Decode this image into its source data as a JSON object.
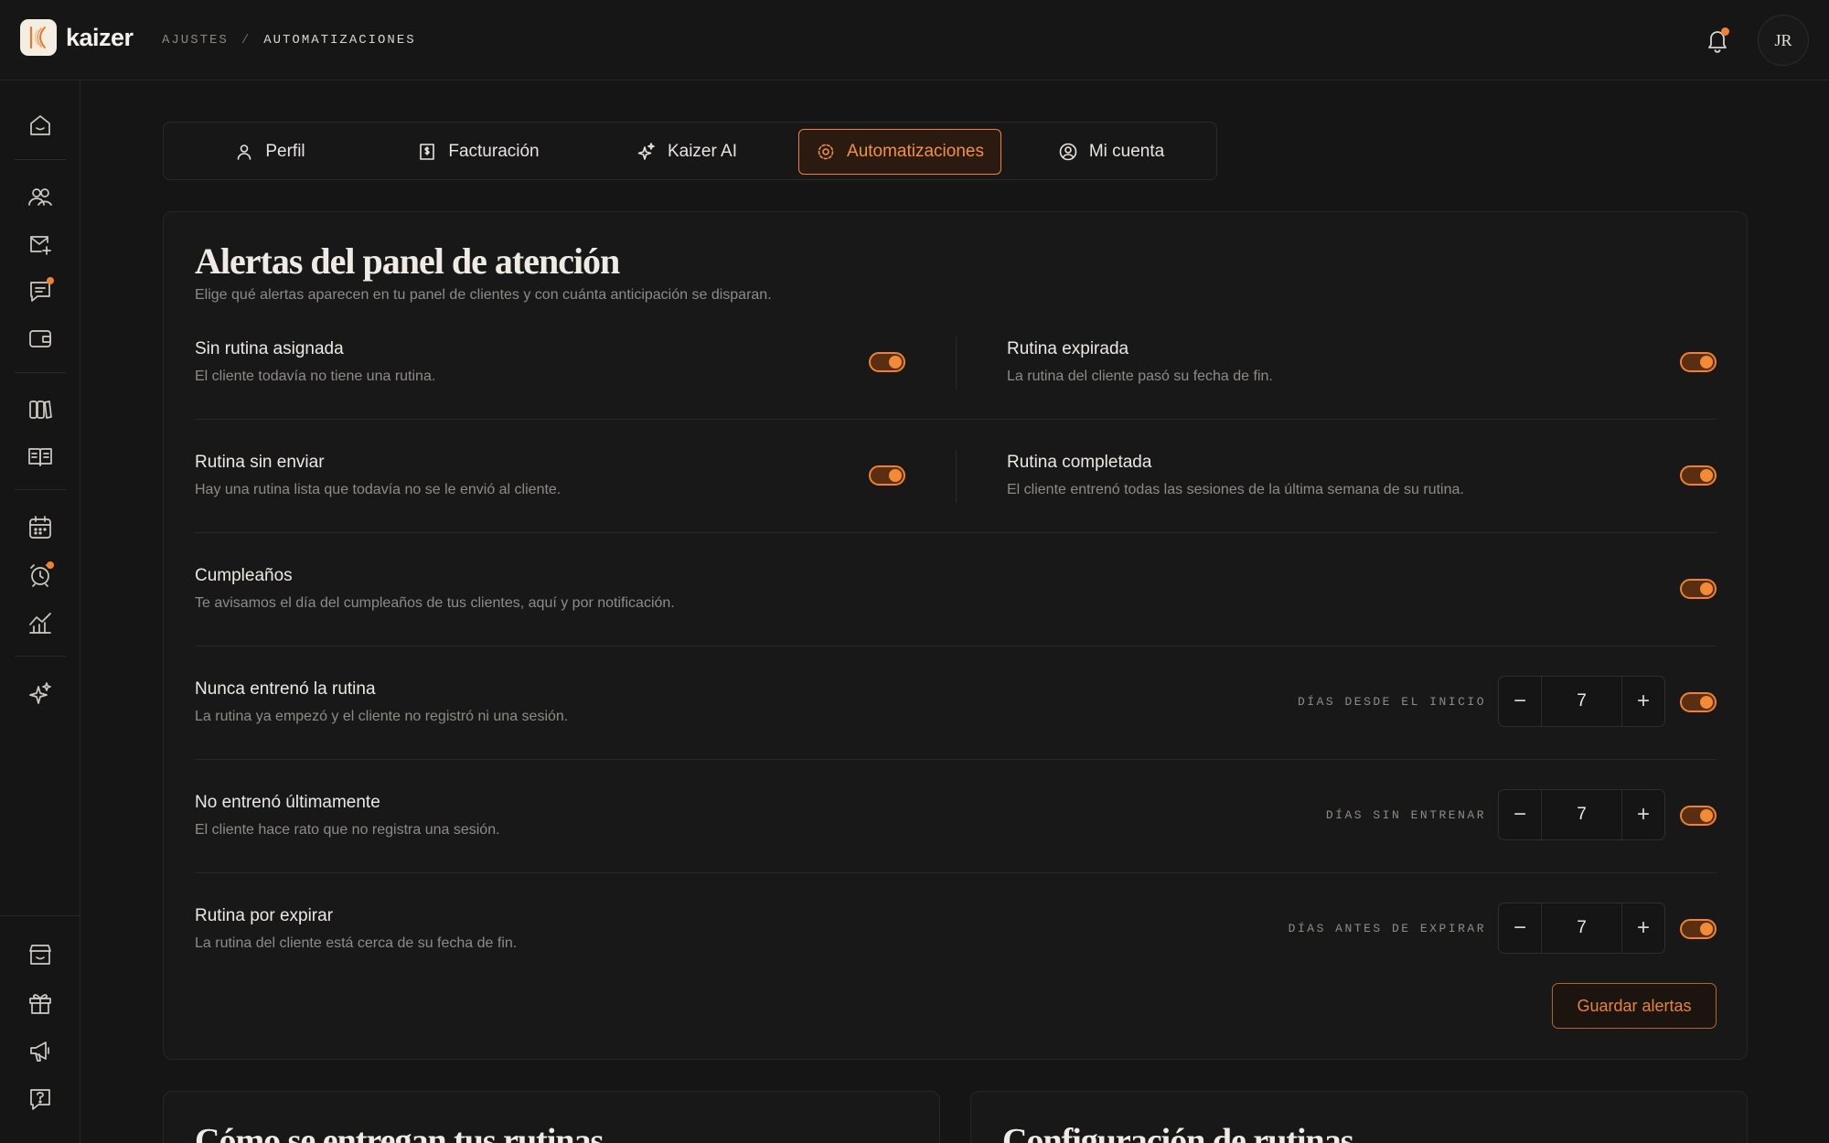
{
  "app": {
    "name": "kaizer",
    "avatar_initials": "JR"
  },
  "breadcrumb": {
    "parent": "AJUSTES",
    "separator": "/",
    "current": "AUTOMATIZACIONES"
  },
  "colors": {
    "accent": "#f0822e",
    "background": "#151515",
    "card": "#181818"
  },
  "sidebar": {
    "items": [
      {
        "icon": "home-icon"
      },
      {
        "icon": "users-icon"
      },
      {
        "icon": "mail-add-icon"
      },
      {
        "icon": "chat-icon",
        "badge": true
      },
      {
        "icon": "wallet-icon"
      },
      {
        "icon": "library-icon"
      },
      {
        "icon": "book-open-icon"
      },
      {
        "icon": "calendar-icon"
      },
      {
        "icon": "alarm-icon",
        "badge": true
      },
      {
        "icon": "chart-icon"
      },
      {
        "icon": "sparkle-icon"
      },
      {
        "icon": "store-icon"
      },
      {
        "icon": "gift-icon"
      },
      {
        "icon": "megaphone-icon"
      },
      {
        "icon": "help-icon"
      }
    ]
  },
  "tabs": [
    {
      "label": "Perfil",
      "icon": "user-icon"
    },
    {
      "label": "Facturación",
      "icon": "receipt-icon"
    },
    {
      "label": "Kaizer AI",
      "icon": "sparkle-icon"
    },
    {
      "label": "Automatizaciones",
      "icon": "gear-icon",
      "active": true
    },
    {
      "label": "Mi cuenta",
      "icon": "user-circle-icon"
    }
  ],
  "alerts": {
    "title": "Alertas del panel de atención",
    "subtitle": "Elige qué alertas aparecen en tu panel de clientes y con cuánta anticipación se disparan.",
    "items": [
      {
        "title": "Sin rutina asignada",
        "desc": "El cliente todavía no tiene una rutina.",
        "enabled": true
      },
      {
        "title": "Rutina expirada",
        "desc": "La rutina del cliente pasó su fecha de fin.",
        "enabled": true
      },
      {
        "title": "Rutina sin enviar",
        "desc": "Hay una rutina lista que todavía no se le envió al cliente.",
        "enabled": true
      },
      {
        "title": "Rutina completada",
        "desc": "El cliente entrenó todas las sesiones de la última semana de su rutina.",
        "enabled": true
      },
      {
        "title": "Cumpleaños",
        "desc": "Te avisamos el día del cumpleaños de tus clientes, aquí y por notificación.",
        "enabled": true
      },
      {
        "title": "Nunca entrenó la rutina",
        "desc": "La rutina ya empezó y el cliente no registró ni una sesión.",
        "stepper_label": "DÍAS DESDE EL INICIO",
        "value": "7",
        "enabled": true
      },
      {
        "title": "No entrenó últimamente",
        "desc": "El cliente hace rato que no registra una sesión.",
        "stepper_label": "DÍAS SIN ENTRENAR",
        "value": "7",
        "enabled": true
      },
      {
        "title": "Rutina por expirar",
        "desc": "La rutina del cliente está cerca de su fecha de fin.",
        "stepper_label": "DÍAS ANTES DE EXPIRAR",
        "value": "7",
        "enabled": true
      }
    ],
    "save_label": "Guardar alertas"
  },
  "bottom_cards": [
    {
      "title": "Cómo se entregan tus rutinas"
    },
    {
      "title": "Configuración de rutinas"
    }
  ]
}
